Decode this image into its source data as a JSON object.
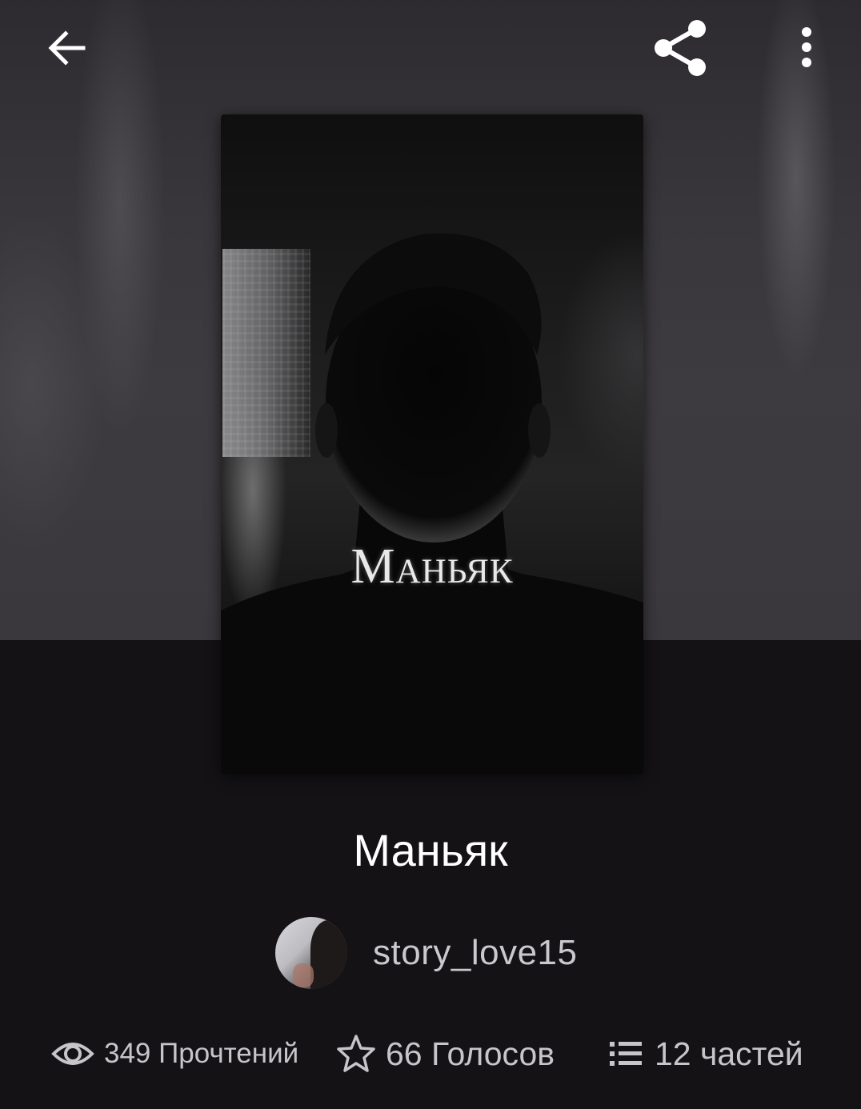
{
  "toolbar": {
    "back_icon": "arrow-left-icon",
    "share_icon": "share-icon",
    "more_icon": "more-vertical-icon"
  },
  "cover": {
    "title": "Маньяк"
  },
  "story": {
    "title": "Маньяк"
  },
  "author": {
    "username": "story_love15",
    "avatar_icon": "avatar"
  },
  "stats": {
    "reads": {
      "icon": "eye-icon",
      "label": "349 Прочтений"
    },
    "votes": {
      "icon": "star-icon",
      "label": "66 Голосов"
    },
    "parts": {
      "icon": "list-icon",
      "label": "12 частей"
    }
  },
  "colors": {
    "background": "#141215",
    "header_backdrop": "#3a383c",
    "text_primary": "#ffffff",
    "text_secondary": "#c6c5c9"
  }
}
